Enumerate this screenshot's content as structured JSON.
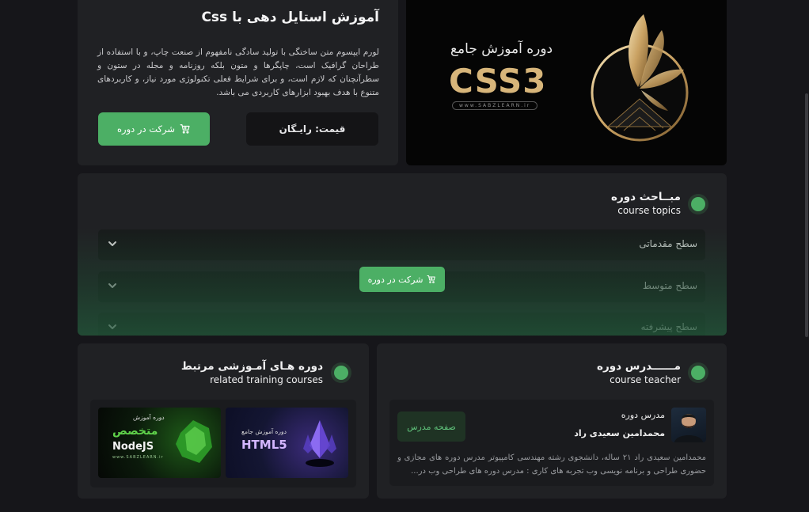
{
  "course": {
    "title": "آموزش استایل دهی با Css",
    "description": "لورم ایپسوم متن ساختگی با تولید سادگی نامفهوم از صنعت چاپ، و با استفاده از طراحان گرافیک است، چاپگرها و متون بلکه روزنامه و مجله در ستون و سطرآنچنان که لازم است، و برای شرایط فعلی تکنولوژی مورد نیاز، و کاربردهای متنوع با هدف بهبود ابزارهای کاربردی می باشد.",
    "price_label": "قیمت: رایـگان",
    "enroll_label": "شرکت در دوره"
  },
  "banner": {
    "subtitle": "دوره آموزش جامع",
    "title": "CSS3",
    "site": "www.SABZLEARN.ir"
  },
  "topics": {
    "title": "مبــاحث دوره",
    "subtitle": "course topics",
    "items": [
      {
        "label": "سطح مقدماتی"
      },
      {
        "label": "سطح متوسط"
      },
      {
        "label": "سطح پیشرفته"
      }
    ],
    "enroll_label": "شرکت در دوره"
  },
  "related": {
    "title": "دوره هـای آمـوزشی مرتبط",
    "subtitle": "related training courses",
    "courses": [
      {
        "small": "دوره آموزش جامع",
        "big": "HTML5"
      },
      {
        "small": "دوره آموزش",
        "big_fa": "متخصص",
        "big": "NodeJS",
        "site": "www.SABZLEARN.ir"
      }
    ]
  },
  "teacher": {
    "title": "مــــــدرس دوره",
    "subtitle": "course teacher",
    "role": "مدرس دوره",
    "name": "محمدامین سعیدی راد",
    "page_button": "صفحه مدرس",
    "bio": "محمدامین سعیدی راد ۲۱ ساله، دانشجوی رشته مهندسی کامپیوتر مدرس دوره های مجازی و حضوری طراحی و برنامه نویسی وب تجربه های کاری : مدرس دوره های طراحی وب در..."
  },
  "colors": {
    "accent": "#4caf65",
    "background": "#16161a",
    "card": "#202124"
  }
}
